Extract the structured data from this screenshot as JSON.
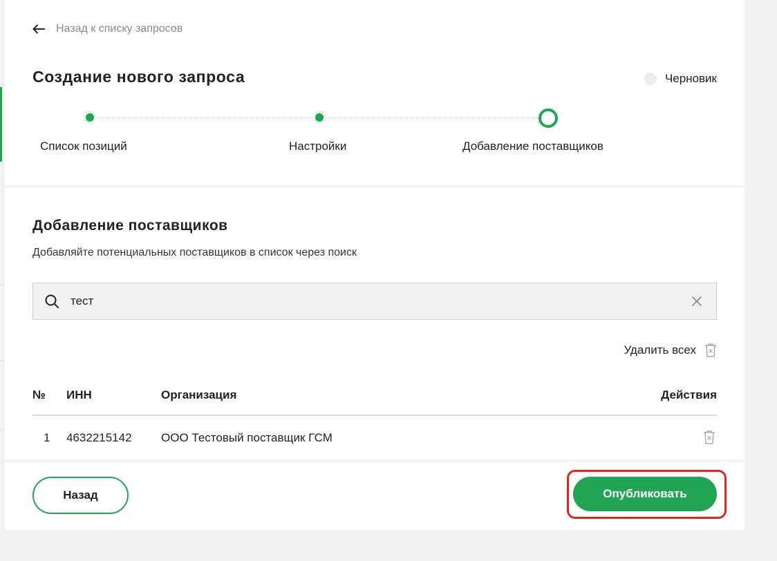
{
  "nav": {
    "back_label": "Назад к списку запросов"
  },
  "header": {
    "title": "Создание нового запроса",
    "status": "Черновик"
  },
  "steps": [
    {
      "label": "Список позиций",
      "state": "done"
    },
    {
      "label": "Настройки",
      "state": "done"
    },
    {
      "label": "Добавление поставщиков",
      "state": "current"
    }
  ],
  "section": {
    "title": "Добавление поставщиков",
    "subtitle": "Добавляйте потенциальных поставщиков в список через поиск"
  },
  "search": {
    "value": "тест"
  },
  "actions": {
    "delete_all_label": "Удалить всех"
  },
  "table": {
    "headers": {
      "num": "№",
      "inn": "ИНН",
      "org": "Организация",
      "actions": "Действия"
    },
    "rows": [
      {
        "num": "1",
        "inn": "4632215142",
        "org": "ООО Тестовый поставщик ГСМ"
      }
    ]
  },
  "footer": {
    "back_label": "Назад",
    "publish_label": "Опубликовать"
  },
  "colors": {
    "accent": "#21a453",
    "highlight": "#e0261b",
    "panel": "#ffffff",
    "background": "#f2f2f2"
  },
  "icons": [
    "arrow-left-icon",
    "search-icon",
    "close-icon",
    "trash-icon"
  ]
}
